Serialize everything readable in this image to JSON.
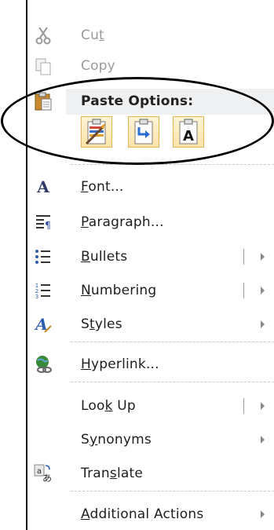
{
  "menu": {
    "cut": {
      "pre": "Cu",
      "key": "t",
      "post": "",
      "icon": "scissors-icon"
    },
    "copy": {
      "label": "Copy",
      "icon": "copy-icon"
    },
    "paste_options": {
      "label": "Paste Options:",
      "icon": "clipboard-icon",
      "buttons": [
        {
          "name": "keep-source-formatting",
          "icon": "paste-keep-source-formatting-icon"
        },
        {
          "name": "merge-formatting",
          "icon": "paste-merge-formatting-icon"
        },
        {
          "name": "keep-text-only",
          "icon": "paste-keep-text-only-icon",
          "glyph": "A"
        }
      ]
    },
    "font": {
      "key": "F",
      "post": "ont...",
      "icon": "font-icon",
      "glyph": "A"
    },
    "paragraph": {
      "key": "P",
      "post": "aragraph...",
      "icon": "paragraph-icon"
    },
    "bullets": {
      "key": "B",
      "post": "ullets",
      "icon": "bullets-icon"
    },
    "numbering": {
      "key": "N",
      "post": "umbering",
      "icon": "numbering-icon"
    },
    "styles": {
      "pre": "S",
      "key": "t",
      "post": "yles",
      "icon": "styles-icon",
      "glyph": "A"
    },
    "hyperlink": {
      "key": "H",
      "post": "yperlink...",
      "icon": "hyperlink-icon"
    },
    "lookup": {
      "pre": "Loo",
      "key": "k",
      "post": " Up"
    },
    "synonyms": {
      "pre": "S",
      "key": "y",
      "post": "nonyms"
    },
    "translate": {
      "pre": "Tran",
      "key": "s",
      "post": "late",
      "icon": "translate-icon",
      "glyph": "a",
      "glyph2": "あ"
    },
    "additional": {
      "key": "A",
      "post": "dditional Actions"
    }
  }
}
